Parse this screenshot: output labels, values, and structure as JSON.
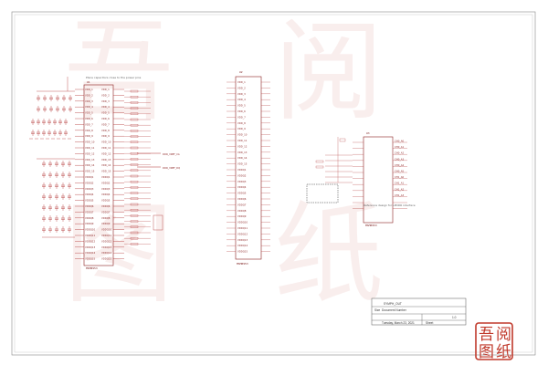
{
  "sheet": {
    "title_block": {
      "title": "SYMPH_OUT",
      "size_label": "Size",
      "doc_label": "Document Number",
      "sheet_label": "Sheet",
      "date": "Tuesday, March 23, 2021",
      "rev": "1.0"
    }
  },
  "parts": {
    "left_ic": {
      "name": "MSM8953",
      "ref": "U1"
    },
    "middle_ic": {
      "name": "MSM8953",
      "ref": "U2"
    },
    "right_ic": {
      "name": "MSM8953",
      "ref": "U3"
    }
  },
  "nets": {
    "left_upper": [
      "VDD_1",
      "VDD_2",
      "VDD_3",
      "VDD_4",
      "VDD_5",
      "VDD_6",
      "VDD_7",
      "VDD_8",
      "VDD_9",
      "VDD_10",
      "VDD_11",
      "VDD_12",
      "VDD_13",
      "VDD_14",
      "VDD_15"
    ],
    "left_lower": [
      "VDDQ1",
      "VDDQ2",
      "VDDQ3",
      "VDDQ4",
      "VDDQ5",
      "VDDQ6",
      "VDDQ7",
      "VDDQ8",
      "VDDQ9",
      "VDDQ10",
      "VDDQ11",
      "VDDQ12",
      "VDDQ13",
      "VDDQ14",
      "VDDQ15"
    ],
    "right_pins": [
      "CH0_A0",
      "CH0_A1",
      "CH0_A2",
      "CH0_A3",
      "CH0_A4",
      "CH0_A5",
      "CH1_A0",
      "CH1_A1",
      "CH1_A2",
      "CH1_A3"
    ],
    "side_labels": [
      "DDR_VREF_CA",
      "DDR_VREF_DQ"
    ]
  },
  "annotations": {
    "left_note": "Place capacitors close to the power pins",
    "right_note": "Reference design for LPDDR interface"
  },
  "colors": {
    "wire": "#b03030",
    "component": "#8a1f1f",
    "watermark": "#c0392b",
    "border": "#555555"
  },
  "watermark": {
    "chars": [
      "吾",
      "阅",
      "图",
      "纸"
    ]
  }
}
